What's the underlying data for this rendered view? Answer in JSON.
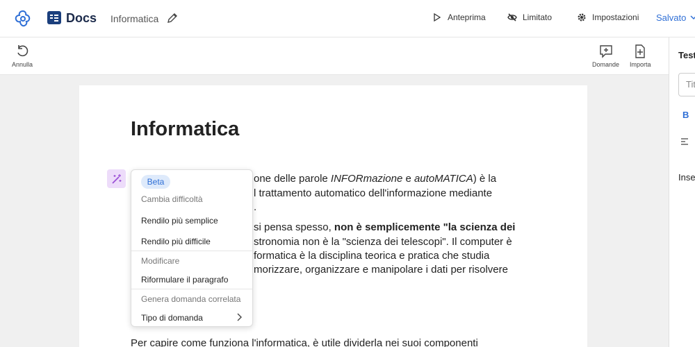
{
  "header": {
    "app_name": "Docs",
    "document_name": "Informatica",
    "actions": [
      {
        "label": "Anteprima",
        "icon": "play-icon"
      },
      {
        "label": "Limitato",
        "icon": "eye-off-icon"
      },
      {
        "label": "Impostazioni",
        "icon": "gear-icon"
      }
    ],
    "status": "Salvato"
  },
  "toolbar": {
    "undo_label": "Annulla",
    "questions_label": "Domande",
    "import_label": "Importa"
  },
  "right_panel": {
    "title": "Testo",
    "input_placeholder": "Titolo",
    "bold_label": "B",
    "insert_label": "Inserisci"
  },
  "document": {
    "title": "Informatica",
    "lines": {
      "l1_pre": "one delle parole ",
      "l1_em1": "INFORmazione",
      "l1_mid": " e ",
      "l1_em2": "autoMATICA",
      "l1_post": ") è la",
      "l2": "l trattamento automatico dell'informazione mediante",
      "l3": ".",
      "l4_pre": "si pensa spesso, ",
      "l4_bold": "non è semplicemente \"la scienza dei",
      "l5": "stronomia non è la \"scienza dei telescopi\". Il computer è",
      "l6": "formatica è la disciplina teorica e pratica che studia",
      "l7": "morizzare, organizzare e manipolare i dati per risolvere",
      "l8": "Per capire come funziona l'informatica, è utile dividerla nei suoi componenti"
    }
  },
  "ai_menu": {
    "badge": "Beta",
    "section1": "Cambia difficoltà",
    "simpler": "Rendilo più semplice",
    "harder": "Rendilo più difficile",
    "section2": "Modificare",
    "rephrase": "Riformulare il paragrafo",
    "section3": "Genera domanda correlata",
    "question_type": "Tipo di domanda"
  },
  "colors": {
    "accent": "#2f6fd6",
    "brand": "#1b3f7d",
    "magic_bg": "#eddcfa",
    "magic_fg": "#9b4fd6"
  }
}
